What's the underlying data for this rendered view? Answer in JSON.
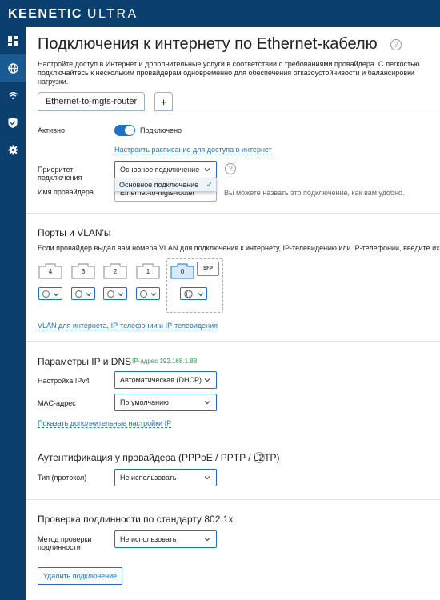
{
  "header": {
    "brand": "KEENETIC",
    "model": "ULTRA"
  },
  "sidebar": {
    "items": [
      {
        "icon": "dashboard-icon"
      },
      {
        "icon": "globe-icon",
        "active": true
      },
      {
        "icon": "wifi-icon"
      },
      {
        "icon": "shield-icon"
      },
      {
        "icon": "gear-icon"
      }
    ]
  },
  "page": {
    "title": "Подключения к интернету по Ethernet-кабелю",
    "help": "?",
    "desc_lines": [
      "Настройте доступ в Интернет и дополнительные услуги в соответствии с требованиями провайдера. С легкостью",
      "подключайтесь к нескольким провайдерам одновременно для обеспечения отказоустойчивости и балансировки",
      "нагрузки."
    ]
  },
  "tabs": {
    "connection": "Ethernet-to-mgts-router",
    "add": "+"
  },
  "general": {
    "active_label": "Активно",
    "active_state": "Подключено",
    "schedule_link": "Настроить расписание для доступа в интернет",
    "priority_label_1": "Приоритет",
    "priority_label_2": "подключения",
    "priority_value": "Основное подключение",
    "dropdown_option": "Основное подключение",
    "dropdown_check": "✓",
    "provider_label": "Имя провайдера",
    "provider_value": "Ethernet-to-mgts-router",
    "provider_hint": "Вы можете назвать это подключение, как вам удобно."
  },
  "ports": {
    "heading": "Порты и VLAN'ы",
    "desc": "Если провайдер выдал вам номера VLAN для подключения к интернету, IP-телевидению или IP-телефонии, введите их в соответствующие поля.",
    "items": [
      "4",
      "3",
      "2",
      "1",
      "0"
    ],
    "sfp": "SFP",
    "vlan_link": "VLAN для интернета, IP-телефонии и IP-телевидения"
  },
  "ip": {
    "heading": "Параметры IP и DNS",
    "address": "IP-адрес 192.168.1.88",
    "ipv4_label": "Настройка IPv4",
    "ipv4_value": "Автоматическая (DHCP)",
    "mac_label": "MAC-адрес",
    "mac_value": "По умолчанию",
    "more_link": "Показать дополнительные настройки IP"
  },
  "auth": {
    "heading": "Аутентификация у провайдера (PPPoE / PPTP / L2TP)",
    "type_label": "Тип (протокол)",
    "type_value": "Не использовать"
  },
  "dot1x": {
    "heading": "Проверка подлинности по стандарту 802.1x",
    "method_label_1": "Метод проверки",
    "method_label_2": "подлинности",
    "method_value": "Не использовать"
  },
  "actions": {
    "delete": "Удалить подключение"
  },
  "colors": {
    "topbar": "#0b3f6e",
    "accent": "#1a73c9",
    "success": "#2a9d50"
  }
}
